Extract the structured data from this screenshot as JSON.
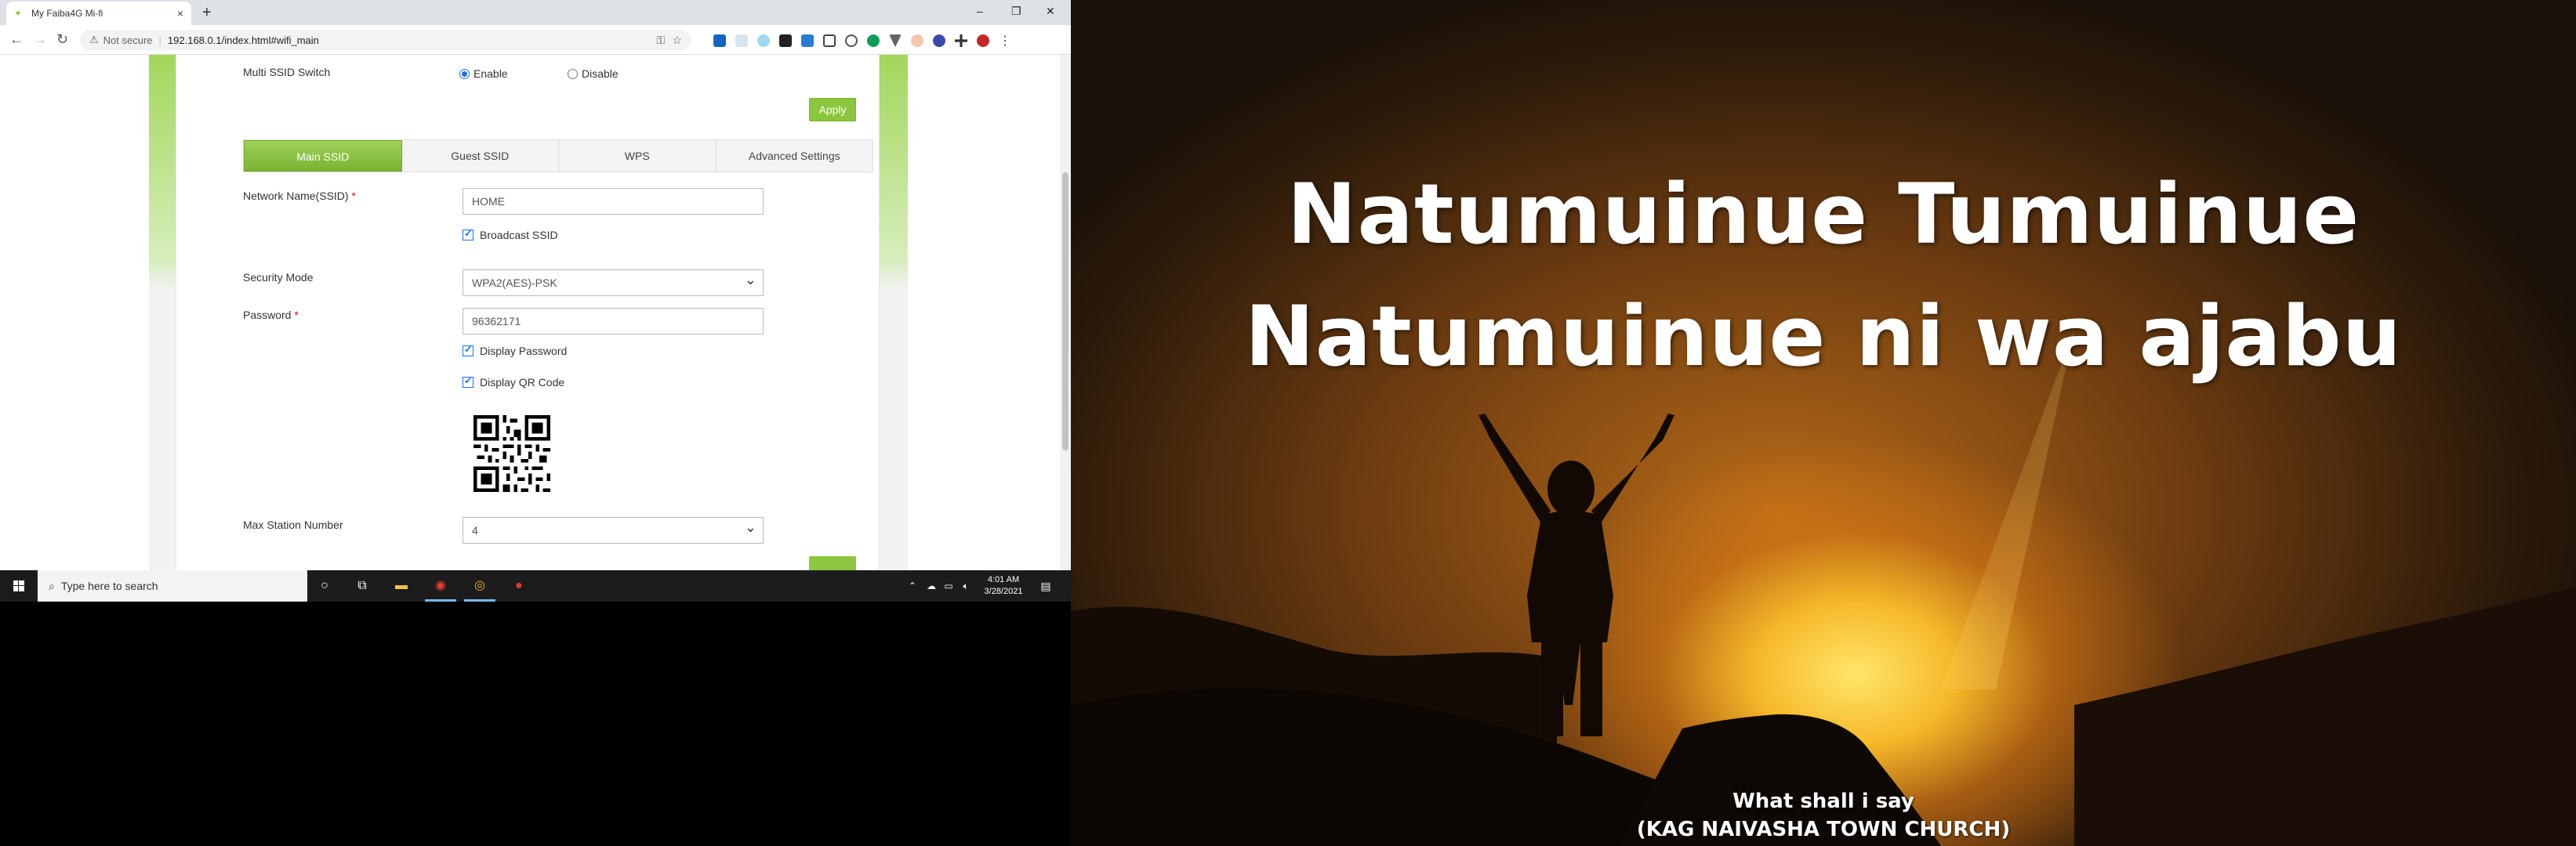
{
  "browser": {
    "tab_title": "My Faiba4G Mi-fi",
    "not_secure": "Not secure",
    "url": "192.168.0.1/index.html#wifi_main",
    "new_tab": "+",
    "tab_close": "×",
    "minimize": "–",
    "restore": "❐",
    "close": "✕"
  },
  "wifi": {
    "multi_ssid_label": "Multi SSID Switch",
    "enable_label": "Enable",
    "disable_label": "Disable",
    "apply_label": "Apply",
    "tabs": [
      {
        "label": "Main SSID"
      },
      {
        "label": "Guest SSID"
      },
      {
        "label": "WPS"
      },
      {
        "label": "Advanced Settings"
      }
    ],
    "network_name_label": "Network Name(SSID)",
    "required_mark": "*",
    "ssid_value": "HOME",
    "broadcast_label": "Broadcast SSID",
    "security_mode_label": "Security Mode",
    "security_mode_value": "WPA2(AES)-PSK",
    "password_label": "Password",
    "password_value": "96362171",
    "display_password_label": "Display Password",
    "display_qr_label": "Display QR Code",
    "max_station_label": "Max Station Number",
    "max_station_value": "4"
  },
  "taskbar": {
    "search_placeholder": "Type here to search",
    "time": "4:01 AM",
    "date": "3/28/2021"
  },
  "slide": {
    "line1": "Natumuinue Tumuinue",
    "line2": "Natumuinue ni wa ajabu",
    "song_title": "What shall i say",
    "church": "(KAG NAIVASHA TOWN CHURCH)"
  }
}
